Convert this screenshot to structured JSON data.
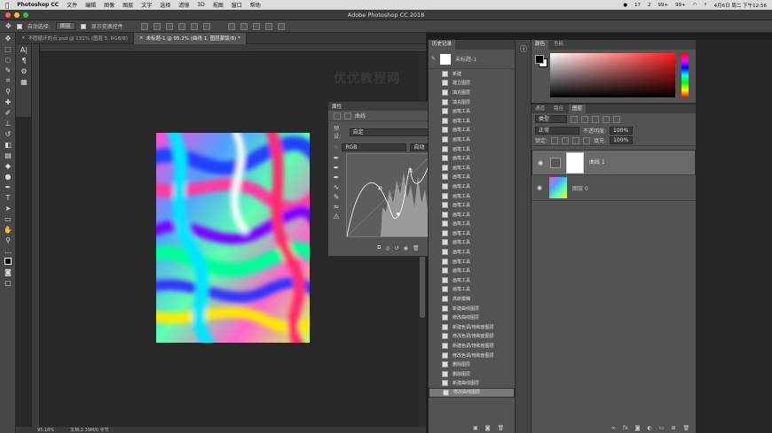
{
  "menubar": {
    "app_name": "Photoshop CC",
    "items": [
      "文件",
      "编辑",
      "图像",
      "图层",
      "文字",
      "选择",
      "滤镜",
      "3D",
      "视图",
      "窗口",
      "帮助"
    ],
    "status_right": [
      "17",
      "2",
      "99+",
      "99+",
      "4月6日 周二 下午12:56"
    ]
  },
  "window": {
    "title": "Adobe Photoshop CC 2018"
  },
  "options": {
    "auto_select_label": "自动选择:",
    "auto_select_value": "图层",
    "show_transform_label": "显示变换控件"
  },
  "tabs": [
    {
      "label": "不圆循环的点.psd @ 131% (图层 5, RGB/8)",
      "active": false
    },
    {
      "label": "未标题-1 @ 95.2% (曲线 1, 图层蒙版/8) *",
      "active": true
    }
  ],
  "canvas": {
    "watermark": "优优教程网"
  },
  "status": {
    "zoom": "95.18%",
    "doc_size": "文档:2.39M/0 字节"
  },
  "properties": {
    "title": "属性",
    "type_label": "曲线",
    "preset_label": "预设:",
    "preset_value": "自定",
    "channel_value": "RGB",
    "auto_button": "自动"
  },
  "history": {
    "tab": "历史记录",
    "snapshot": "未标题-1",
    "items": [
      "新建",
      "建立图层",
      "填充图层",
      "填充图层",
      "画笔工具",
      "画笔工具",
      "画笔工具",
      "画笔工具",
      "画笔工具",
      "画笔工具",
      "画笔工具",
      "画笔工具",
      "画笔工具",
      "画笔工具",
      "画笔工具",
      "画笔工具",
      "画笔工具",
      "画笔工具",
      "画笔工具",
      "画笔工具",
      "画笔工具",
      "画笔工具",
      "画笔工具",
      "画笔工具",
      "高斯模糊",
      "新建曲线图层",
      "修改曲线图层",
      "新建色调/饱和度图层",
      "修改色调/饱和度图层",
      "新建色调/饱和度图层",
      "修改色调/饱和度图层",
      "删除图层",
      "删除图层",
      "新建曲线图层",
      "修改曲线图层"
    ],
    "selected_index": 34
  },
  "color_panel": {
    "tabs": [
      "颜色",
      "色板"
    ]
  },
  "layers_panel": {
    "tabs": [
      "通道",
      "路径",
      "图层"
    ],
    "kind_label": "类型",
    "blend_mode": "正常",
    "opacity_label": "不透明度:",
    "opacity_value": "100%",
    "lock_label": "锁定:",
    "fill_label": "填充:",
    "fill_value": "100%",
    "layers": [
      {
        "name": "曲线 1",
        "selected": true
      },
      {
        "name": "图层 0",
        "selected": false
      }
    ]
  },
  "colors": {
    "accent": "#ff1a1a",
    "menubar": "#dcdcdc",
    "panel": "#535353"
  }
}
